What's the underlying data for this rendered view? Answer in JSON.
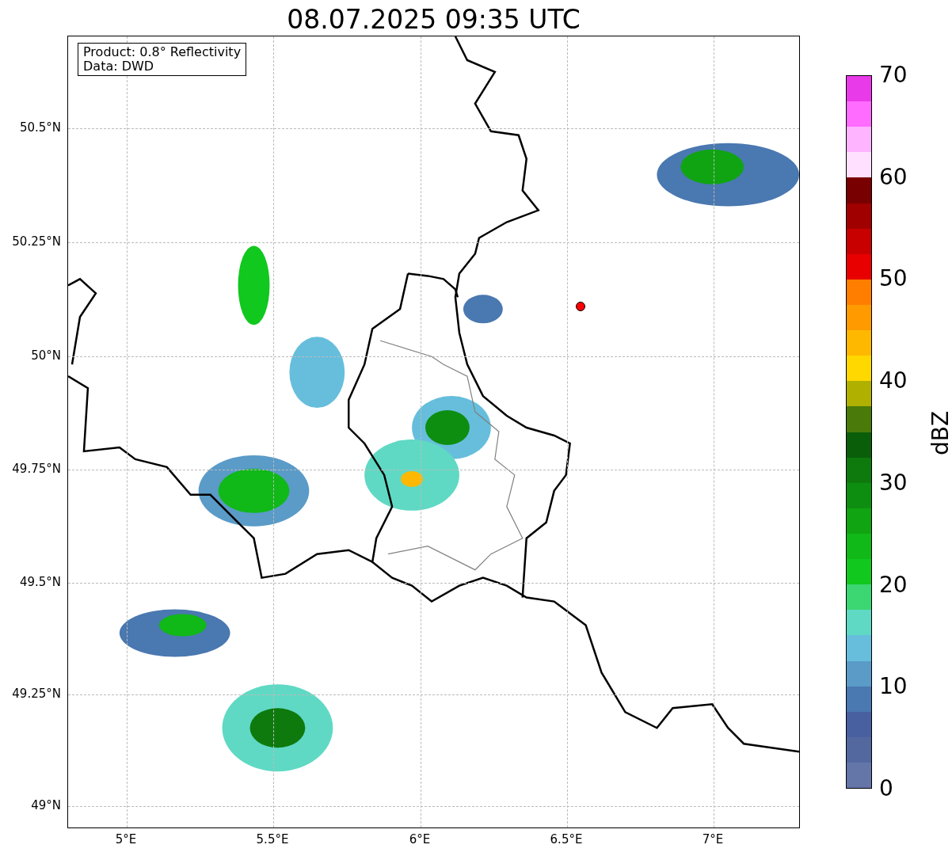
{
  "title": "08.07.2025 09:35 UTC",
  "map": {
    "legend": [
      "Product: 0.8° Reflectivity",
      "Data: DWD"
    ],
    "y_ticks": [
      "50.5°N",
      "50.25°N",
      "50°N",
      "49.75°N",
      "49.5°N",
      "49.25°N",
      "49°N"
    ],
    "x_ticks": [
      "5°E",
      "5.5°E",
      "6°E",
      "6.5°E",
      "7°E"
    ]
  },
  "colorbar": {
    "ticks": [
      "70",
      "60",
      "50",
      "40",
      "30",
      "20",
      "10",
      "0"
    ],
    "label": "dBZ",
    "levels": [
      {
        "color": "#e83ae8"
      },
      {
        "color": "#ff6cff"
      },
      {
        "color": "#ffb4ff"
      },
      {
        "color": "#ffe0ff"
      },
      {
        "color": "#780000"
      },
      {
        "color": "#a00000"
      },
      {
        "color": "#c80000"
      },
      {
        "color": "#e80000"
      },
      {
        "color": "#ff7e00"
      },
      {
        "color": "#ff9a00"
      },
      {
        "color": "#ffb800"
      },
      {
        "color": "#ffd800"
      },
      {
        "color": "#b0b000"
      },
      {
        "color": "#4a7a0a"
      },
      {
        "color": "#0a5e0a"
      },
      {
        "color": "#0e7a0e"
      },
      {
        "color": "#0e8e10"
      },
      {
        "color": "#10a412"
      },
      {
        "color": "#10b818"
      },
      {
        "color": "#10c81e"
      },
      {
        "color": "#3cd672"
      },
      {
        "color": "#5fd9c4"
      },
      {
        "color": "#66bedc"
      },
      {
        "color": "#5a9bc8"
      },
      {
        "color": "#4a78b0"
      },
      {
        "color": "#4860a0"
      },
      {
        "color": "#5468a0"
      },
      {
        "color": "#6475a8"
      }
    ]
  }
}
